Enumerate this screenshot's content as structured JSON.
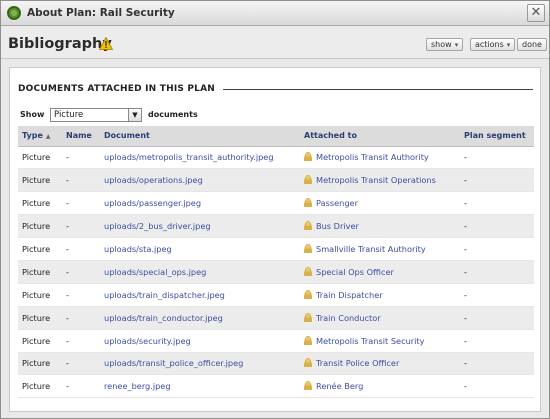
{
  "window": {
    "title": "About Plan: Rail Security"
  },
  "header": {
    "title": "Bibliography",
    "buttons": {
      "show": "show",
      "actions": "actions",
      "done": "done"
    }
  },
  "section": {
    "title": "DOCUMENTS ATTACHED IN THIS PLAN",
    "show_label": "Show",
    "filter_value": "Picture",
    "documents_label": "documents"
  },
  "table": {
    "columns": [
      "Type",
      "Name",
      "Document",
      "Attached to",
      "Plan segment"
    ],
    "rows": [
      {
        "type": "Picture",
        "name": "-",
        "document": "uploads/metropolis_transit_authority.jpeg",
        "attached": "Metropolis Transit Authority",
        "segment": "-"
      },
      {
        "type": "Picture",
        "name": "-",
        "document": "uploads/operations.jpeg",
        "attached": "Metropolis Transit Operations",
        "segment": "-"
      },
      {
        "type": "Picture",
        "name": "-",
        "document": "uploads/passenger.jpeg",
        "attached": "Passenger",
        "segment": "-"
      },
      {
        "type": "Picture",
        "name": "-",
        "document": "uploads/2_bus_driver.jpeg",
        "attached": "Bus Driver",
        "segment": "-"
      },
      {
        "type": "Picture",
        "name": "-",
        "document": "uploads/sta.jpeg",
        "attached": "Smallville Transit Authority",
        "segment": "-"
      },
      {
        "type": "Picture",
        "name": "-",
        "document": "uploads/special_ops.jpeg",
        "attached": "Special Ops Officer",
        "segment": "-"
      },
      {
        "type": "Picture",
        "name": "-",
        "document": "uploads/train_dispatcher.jpeg",
        "attached": "Train Dispatcher",
        "segment": "-"
      },
      {
        "type": "Picture",
        "name": "-",
        "document": "uploads/train_conductor.jpeg",
        "attached": "Train Conductor",
        "segment": "-"
      },
      {
        "type": "Picture",
        "name": "-",
        "document": "uploads/security.jpeg",
        "attached": "Metropolis Transit Security",
        "segment": "-"
      },
      {
        "type": "Picture",
        "name": "-",
        "document": "uploads/transit_police_officer.jpeg",
        "attached": "Transit Police Officer",
        "segment": "-"
      },
      {
        "type": "Picture",
        "name": "-",
        "document": "renee_berg.jpeg",
        "attached": "Renée Berg",
        "segment": "-"
      }
    ]
  },
  "icons": {
    "app": "plan-logo-icon",
    "close": "close-icon",
    "warning": "warning-icon",
    "sort": "sort-ascending-icon",
    "user": "user-icon"
  }
}
